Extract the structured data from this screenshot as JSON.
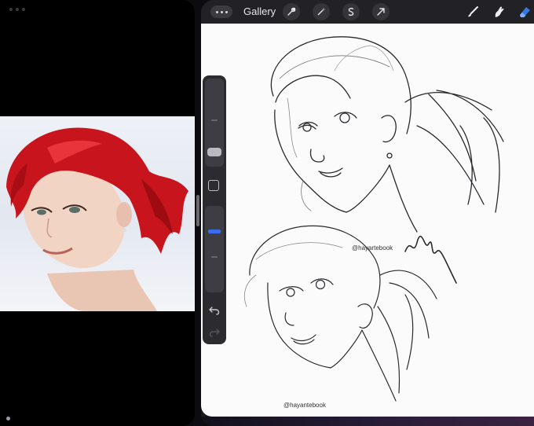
{
  "toolbar": {
    "gallery_label": "Gallery",
    "left_tools": [
      "wrench-icon",
      "magic-wand-icon",
      "selection-s-icon",
      "transform-arrow-icon"
    ],
    "right_tools": [
      "brush-icon",
      "smudge-icon",
      "eraser-icon"
    ],
    "accent_color": "#2f78e6"
  },
  "canvas": {
    "signatures": [
      "@hayantebook",
      "@hayartebook"
    ]
  },
  "sidebar": {
    "controls": [
      "brush-size-slider",
      "modify-button",
      "opacity-slider",
      "undo-button",
      "redo-button"
    ]
  },
  "colors": {
    "hair_red": "#c8141c",
    "canvas_bg": "#fbfbfb",
    "slider_active": "#3a6df0"
  }
}
